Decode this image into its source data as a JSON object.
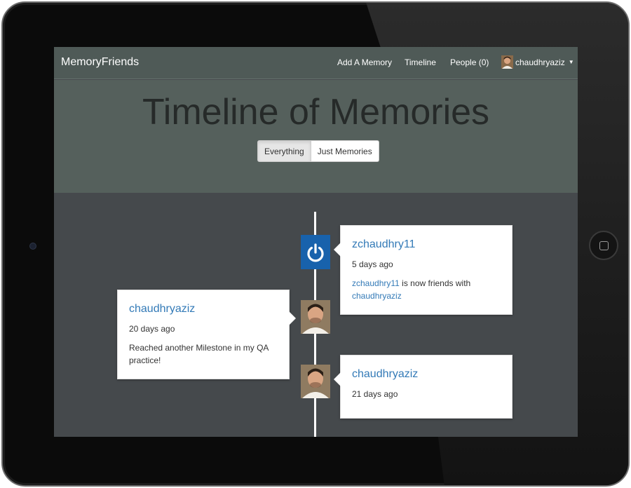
{
  "navbar": {
    "brand": "MemoryFriends",
    "add_memory": "Add A Memory",
    "timeline": "Timeline",
    "people": "People (0)",
    "username": "chaudhryaziz"
  },
  "header": {
    "title": "Timeline of Memories",
    "filters": [
      "Everything",
      "Just Memories"
    ],
    "active_filter": "Everything"
  },
  "timeline": [
    {
      "user": "zchaudhry11",
      "time": "5 days ago",
      "text_link1": "zchaudhry11",
      "text_middle": " is now friends with ",
      "text_link2": "chaudhryaziz",
      "icon": "power-icon",
      "side": "right"
    },
    {
      "user": "chaudhryaziz",
      "time": "20 days ago",
      "text": "Reached another Milestone in my QA practice!",
      "icon": "avatar",
      "side": "left"
    },
    {
      "user": "chaudhryaziz",
      "time": "21 days ago",
      "icon": "avatar",
      "side": "right"
    }
  ],
  "colors": {
    "navbar": "#4f5a57",
    "header": "#55605c",
    "body": "#45494c",
    "link": "#337ab7",
    "power_icon_bg": "#1862ac"
  }
}
